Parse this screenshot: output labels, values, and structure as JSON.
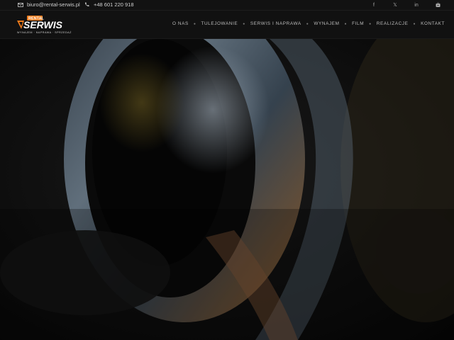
{
  "topbar": {
    "email": "biuro@rental-serwis.pl",
    "phone": "+48 601 220 918",
    "social_icons": [
      "facebook-icon",
      "x-twitter-icon",
      "linkedin-icon",
      "youtube-icon"
    ]
  },
  "logo": {
    "brand": "SERWIS",
    "tag": "RENTAL",
    "tagline": "WYNAJEM · NAPRAWA · SPRZEDAŻ"
  },
  "nav": {
    "items": [
      "O NAS",
      "TULEJOWANIE",
      "SERWIS I NAPRAWA",
      "WYNAJEM",
      "FILM",
      "REALIZACJE",
      "KONTAKT"
    ]
  },
  "colors": {
    "accent": "#f07a1a",
    "topbar_bg": "#121212",
    "header_bg": "#111111"
  }
}
